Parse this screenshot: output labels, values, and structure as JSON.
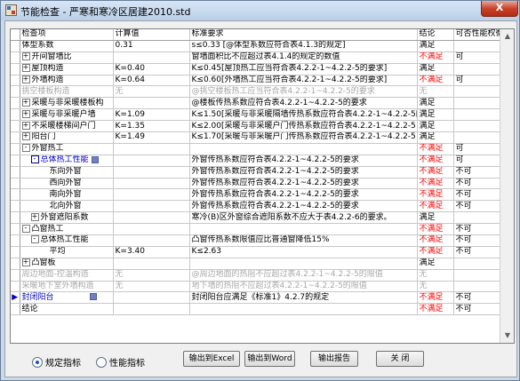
{
  "window": {
    "title": "节能检查 - 严寒和寒冷区居建2010.std",
    "close_label": "X"
  },
  "columns": [
    "检查项",
    "计算值",
    "标准要求",
    "结论",
    "可否性能权衡"
  ],
  "rows": [
    {
      "item": "体型系数",
      "value": "0.31",
      "req": "s≤0.33 [@体型系数应符合表4.1.3的规定]",
      "result": "满足",
      "trade": "",
      "level": 0,
      "exp": "",
      "style": ""
    },
    {
      "item": "开间窗墙比",
      "value": "",
      "req": "窗墙面积比不应超过表4.1.4的规定的数值",
      "result": "不满足",
      "trade": "可",
      "level": 0,
      "exp": "+",
      "style": ""
    },
    {
      "item": "屋顶构造",
      "value": "K=0.40",
      "req": "K≤0.45[屋顶热工应当符合表4.2.2-1~4.2.2-5的要求]",
      "result": "满足",
      "trade": "",
      "level": 0,
      "exp": "+",
      "style": ""
    },
    {
      "item": "外墙构造",
      "value": "K=0.64",
      "req": "K≤0.60[外墙热工应当符合表4.2.2-1~4.2.2-5的要求]",
      "result": "不满足",
      "trade": "可",
      "level": 0,
      "exp": "+",
      "style": ""
    },
    {
      "item": "挑空楼板构造",
      "value": "无",
      "req": "@挑空楼板热工应当符合表4.2.2-1~4.2.2-5的要求",
      "result": "无",
      "trade": "",
      "level": 0,
      "exp": "",
      "style": "grey"
    },
    {
      "item": "采暖与非采暖楼板构",
      "value": "",
      "req": "@楼板传热系数应符合表4.2.2-1~4.2.2-5的要求",
      "result": "满足",
      "trade": "",
      "level": 0,
      "exp": "+",
      "style": ""
    },
    {
      "item": "采暖与非采暖户墙",
      "value": "K=1.09",
      "req": "K≤1.50[采暖与非采暖隔墙传热系数应符合表4.2.2-1~4.2.2-5的",
      "result": "满足",
      "trade": "",
      "level": 0,
      "exp": "+",
      "style": ""
    },
    {
      "item": "不采暖楼梯间户门",
      "value": "K=1.35",
      "req": "K≤2.00[采暖与非采暖户门传热系数应符合表4.2.2-1~4.2.2-5",
      "result": "满足",
      "trade": "",
      "level": 0,
      "exp": "+",
      "style": ""
    },
    {
      "item": "阳台门",
      "value": "K=1.49",
      "req": "K≤1.70[采暖与非采暖户门传热系数应符合表4.2.2-1~4.2.2-5",
      "result": "满足",
      "trade": "",
      "level": 0,
      "exp": "+",
      "style": ""
    },
    {
      "item": "外窗热工",
      "value": "",
      "req": "",
      "result": "不满足",
      "trade": "可",
      "level": 0,
      "exp": "-",
      "style": ""
    },
    {
      "item": "总体热工性能",
      "value": "",
      "req": "外窗传热系数应符合表4.2.2-1~4.2.2-5的要求",
      "result": "不满足",
      "trade": "可",
      "level": 1,
      "exp": "-",
      "style": "blue"
    },
    {
      "item": "东向外窗",
      "value": "",
      "req": "外窗传热系数应符合表4.2.2-1~4.2.2-5的要求",
      "result": "不满足",
      "trade": "不可",
      "level": 2,
      "exp": "",
      "style": ""
    },
    {
      "item": "西向外窗",
      "value": "",
      "req": "外窗传热系数应符合表4.2.2-1~4.2.2-5的要求",
      "result": "不满足",
      "trade": "不可",
      "level": 2,
      "exp": "",
      "style": ""
    },
    {
      "item": "南向外窗",
      "value": "",
      "req": "外窗传热系数应符合表4.2.2-1~4.2.2-5的要求",
      "result": "不满足",
      "trade": "不可",
      "level": 2,
      "exp": "",
      "style": ""
    },
    {
      "item": "北向外窗",
      "value": "",
      "req": "外窗传热系数应符合表4.2.2-1~4.2.2-5的要求",
      "result": "不满足",
      "trade": "不可",
      "level": 2,
      "exp": "",
      "style": ""
    },
    {
      "item": "外窗遮阳系数",
      "value": "",
      "req": "寒冷(B)区外窗综合遮阳系数不应大于表4.2.2-6的要求。",
      "result": "满足",
      "trade": "",
      "level": 1,
      "exp": "+",
      "style": ""
    },
    {
      "item": "凸窗热工",
      "value": "",
      "req": "",
      "result": "不满足",
      "trade": "不可",
      "level": 0,
      "exp": "-",
      "style": ""
    },
    {
      "item": "总体热工性能",
      "value": "",
      "req": "凸窗传热系数限值应比普通窗降低15%",
      "result": "不满足",
      "trade": "不可",
      "level": 1,
      "exp": "-",
      "style": ""
    },
    {
      "item": "平均",
      "value": "K=3.40",
      "req": "K≤2.63",
      "result": "不满足",
      "trade": "不可",
      "level": 2,
      "exp": "",
      "style": ""
    },
    {
      "item": "凸窗板",
      "value": "",
      "req": "",
      "result": "满足",
      "trade": "",
      "level": 0,
      "exp": "+",
      "style": ""
    },
    {
      "item": "周边地面-控温构造",
      "value": "无",
      "req": "@周边地面的热阻不应超过表4.2.2-1~4.2.2-5的限值",
      "result": "无",
      "trade": "",
      "level": 0,
      "exp": "",
      "style": "grey"
    },
    {
      "item": "采暖地下室外墙构造",
      "value": "无",
      "req": "地下墙的热阻不应超过表4.2.2-1~4.2.2-5的限值",
      "result": "无",
      "trade": "",
      "level": 0,
      "exp": "",
      "style": "grey"
    },
    {
      "item": "封闭阳台",
      "value": "",
      "req": "封闭阳台应满足《标准1》4.2.7的规定",
      "result": "不满足",
      "trade": "不可",
      "level": 0,
      "exp": "",
      "style": "blue",
      "marker": "▶"
    },
    {
      "item": "结论",
      "value": "",
      "req": "",
      "result": "不满足",
      "trade": "不可",
      "level": 0,
      "exp": "",
      "style": ""
    }
  ],
  "bottom": {
    "radio_spec": "规定指标",
    "radio_perf": "性能指标",
    "btn_excel": "输出到Excel",
    "btn_word": "输出到Word",
    "btn_report": "输出报告",
    "btn_close": "关 闭"
  },
  "colors": {
    "fail": "#ff0000",
    "grey": "#a8a8a8",
    "link": "#0000c0"
  }
}
